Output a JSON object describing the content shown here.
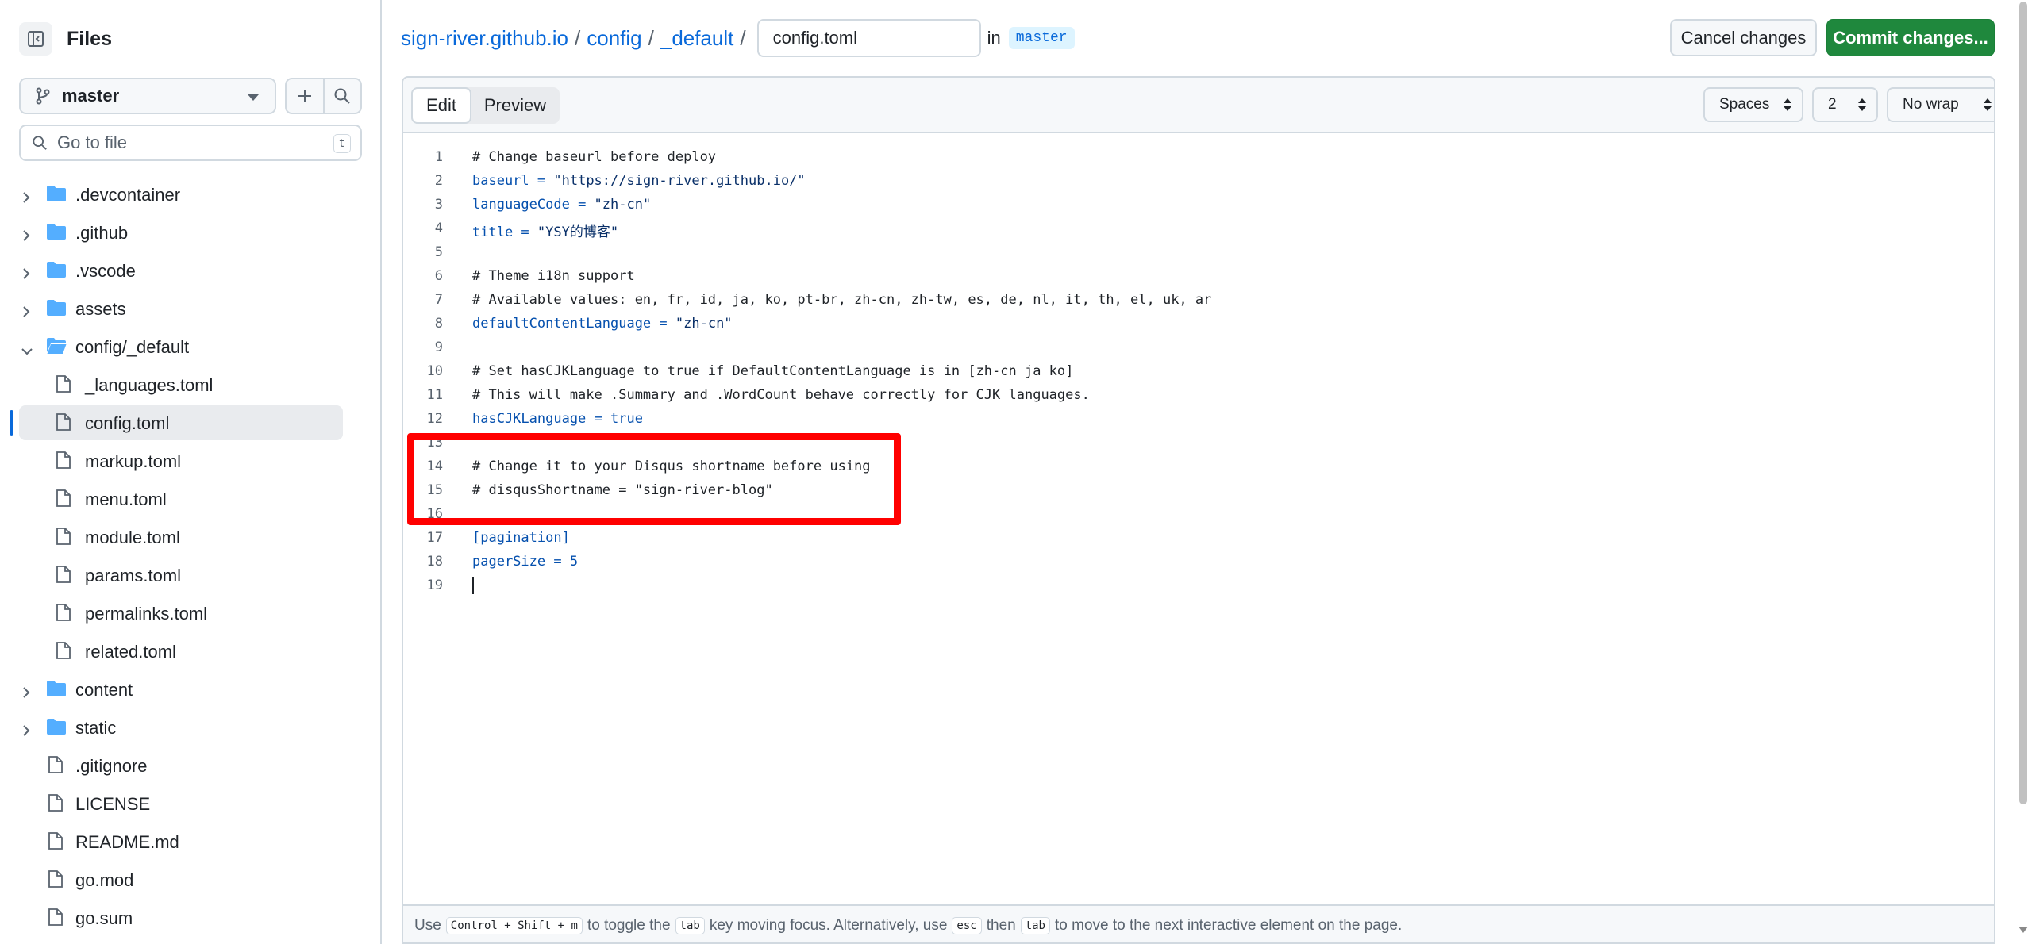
{
  "sidebar": {
    "title": "Files",
    "branch": "master",
    "search_placeholder": "Go to file",
    "search_shortcut": "t",
    "tree": [
      {
        "label": ".devcontainer",
        "type": "folder",
        "depth": 0,
        "expanded": false
      },
      {
        "label": ".github",
        "type": "folder",
        "depth": 0,
        "expanded": false
      },
      {
        "label": ".vscode",
        "type": "folder",
        "depth": 0,
        "expanded": false
      },
      {
        "label": "assets",
        "type": "folder",
        "depth": 0,
        "expanded": false
      },
      {
        "label": "config/_default",
        "type": "folder",
        "depth": 0,
        "expanded": true
      },
      {
        "label": "_languages.toml",
        "type": "file",
        "depth": 1
      },
      {
        "label": "config.toml",
        "type": "file",
        "depth": 1,
        "selected": true
      },
      {
        "label": "markup.toml",
        "type": "file",
        "depth": 1
      },
      {
        "label": "menu.toml",
        "type": "file",
        "depth": 1
      },
      {
        "label": "module.toml",
        "type": "file",
        "depth": 1
      },
      {
        "label": "params.toml",
        "type": "file",
        "depth": 1
      },
      {
        "label": "permalinks.toml",
        "type": "file",
        "depth": 1
      },
      {
        "label": "related.toml",
        "type": "file",
        "depth": 1
      },
      {
        "label": "content",
        "type": "folder",
        "depth": 0,
        "expanded": false
      },
      {
        "label": "static",
        "type": "folder",
        "depth": 0,
        "expanded": false
      },
      {
        "label": ".gitignore",
        "type": "file",
        "depth": 0
      },
      {
        "label": "LICENSE",
        "type": "file",
        "depth": 0
      },
      {
        "label": "README.md",
        "type": "file",
        "depth": 0
      },
      {
        "label": "go.mod",
        "type": "file",
        "depth": 0
      },
      {
        "label": "go.sum",
        "type": "file",
        "depth": 0
      }
    ]
  },
  "breadcrumb": {
    "repo": "sign-river.github.io",
    "sep": "/",
    "dir1": "config",
    "dir2": "_default",
    "filename": "config.toml",
    "in_label": "in",
    "branch": "master"
  },
  "actions": {
    "cancel": "Cancel changes",
    "commit": "Commit changes..."
  },
  "editor": {
    "tab_edit": "Edit",
    "tab_preview": "Preview",
    "indent_mode": "Spaces",
    "indent_size": "2",
    "wrap_mode": "No wrap",
    "lines": [
      [
        {
          "t": "# Change baseurl before deploy",
          "c": "comment"
        }
      ],
      [
        {
          "t": "baseurl",
          "c": "key"
        },
        {
          "t": " = ",
          "c": "op"
        },
        {
          "t": "\"https://sign-river.github.io/\"",
          "c": "str"
        }
      ],
      [
        {
          "t": "languageCode",
          "c": "key"
        },
        {
          "t": " = ",
          "c": "op"
        },
        {
          "t": "\"zh-cn\"",
          "c": "str"
        }
      ],
      [
        {
          "t": "title",
          "c": "key"
        },
        {
          "t": " = ",
          "c": "op"
        },
        {
          "t": "\"YSY的博客\"",
          "c": "str"
        }
      ],
      [],
      [
        {
          "t": "# Theme i18n support",
          "c": "comment"
        }
      ],
      [
        {
          "t": "# Available values: en, fr, id, ja, ko, pt-br, zh-cn, zh-tw, es, de, nl, it, th, el, uk, ar",
          "c": "comment"
        }
      ],
      [
        {
          "t": "defaultContentLanguage",
          "c": "key"
        },
        {
          "t": " = ",
          "c": "op"
        },
        {
          "t": "\"zh-cn\"",
          "c": "str"
        }
      ],
      [],
      [
        {
          "t": "# Set hasCJKLanguage to true if DefaultContentLanguage is in [zh-cn ja ko]",
          "c": "comment"
        }
      ],
      [
        {
          "t": "# This will make .Summary and .WordCount behave correctly for CJK languages.",
          "c": "comment"
        }
      ],
      [
        {
          "t": "hasCJKLanguage",
          "c": "key"
        },
        {
          "t": " = ",
          "c": "op"
        },
        {
          "t": "true",
          "c": "bool"
        }
      ],
      [],
      [
        {
          "t": "# Change it to your Disqus shortname before using",
          "c": "comment"
        }
      ],
      [
        {
          "t": "# disqusShortname = \"sign-river-blog\"",
          "c": "comment"
        }
      ],
      [],
      [
        {
          "t": "[pagination]",
          "c": "sec"
        }
      ],
      [
        {
          "t": "pagerSize",
          "c": "key"
        },
        {
          "t": " = ",
          "c": "op"
        },
        {
          "t": "5",
          "c": "num"
        }
      ],
      []
    ]
  },
  "footer": {
    "p1": "Use",
    "k1": "Control + Shift + m",
    "p2": "to toggle the",
    "k2": "tab",
    "p3": "key moving focus. Alternatively, use",
    "k3": "esc",
    "p4": "then",
    "k4": "tab",
    "p5": "to move to the next interactive element on the page."
  },
  "colors": {
    "accent": "#0969da",
    "commit_bg": "#1f883d",
    "folder": "#54aeff",
    "highlight": "#ff0000"
  }
}
